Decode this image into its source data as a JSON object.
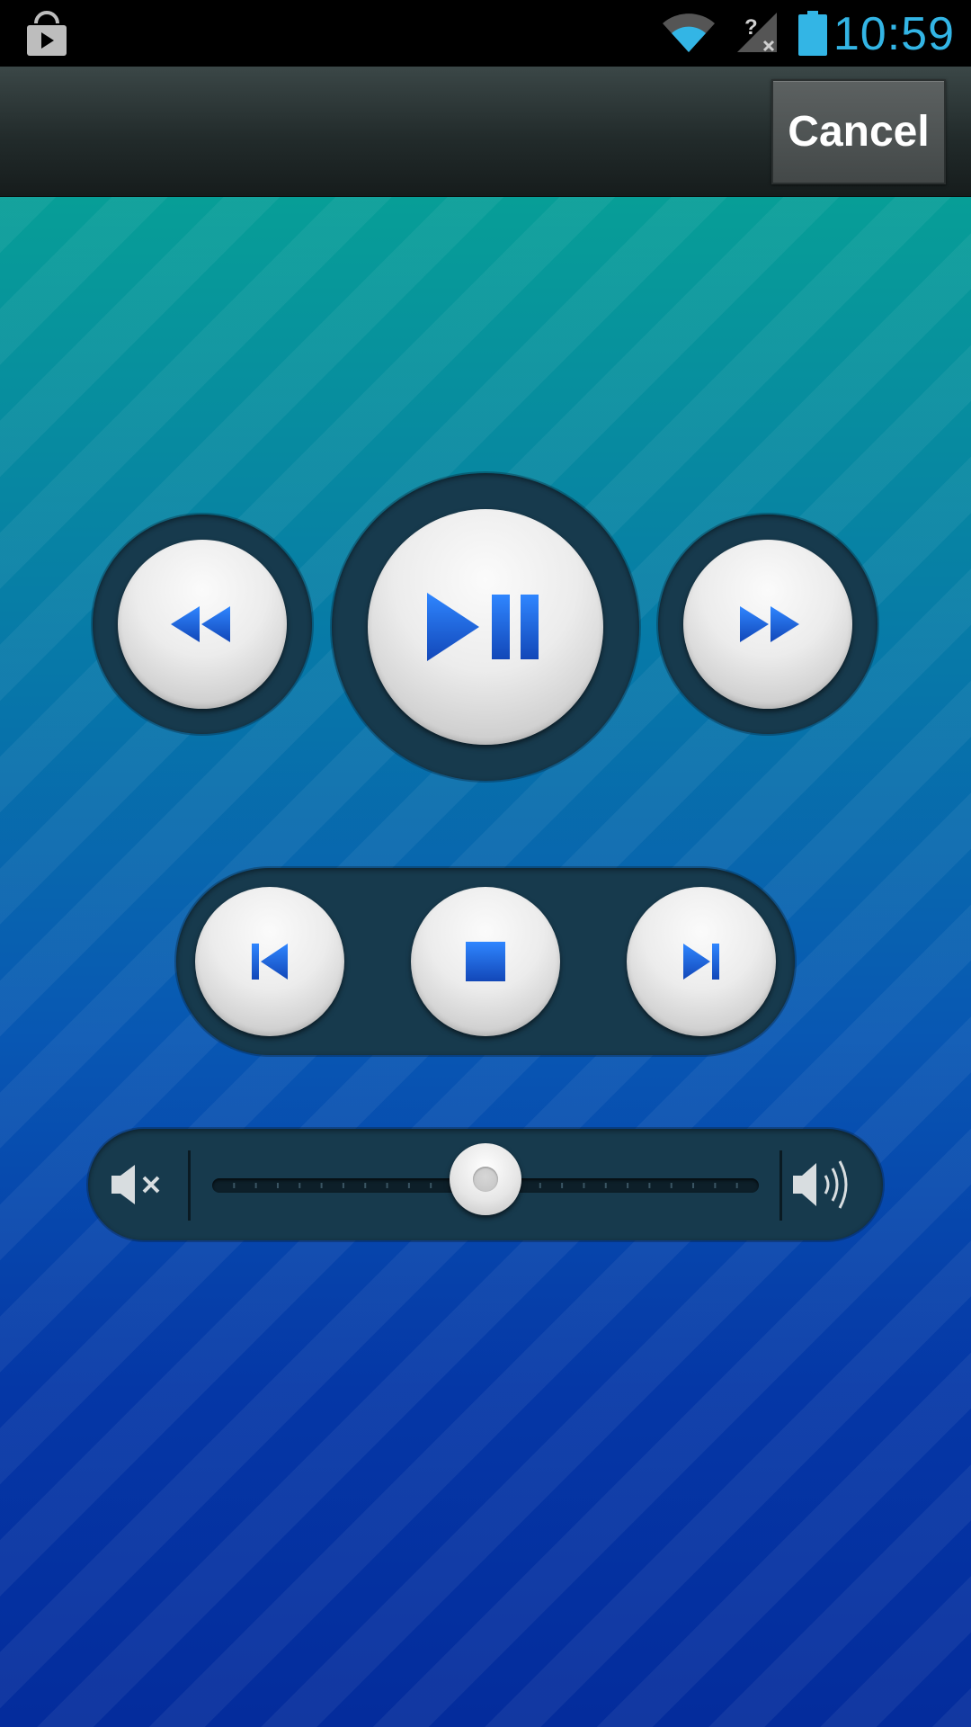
{
  "status_bar": {
    "time": "10:59",
    "icons": [
      "play-store-icon",
      "wifi-icon",
      "no-sim-signal-icon",
      "battery-icon"
    ],
    "time_color": "#33b5e5"
  },
  "action_bar": {
    "cancel_label": "Cancel"
  },
  "controls": {
    "primary": [
      "rewind-icon",
      "play-pause-icon",
      "fast-forward-icon"
    ],
    "secondary": [
      "skip-previous-icon",
      "stop-icon",
      "skip-next-icon"
    ],
    "icon_color": "#1e5fd0"
  },
  "volume": {
    "level": 0.5,
    "tick_count": 25,
    "icons": [
      "volume-mute-icon",
      "volume-max-icon"
    ]
  },
  "colors": {
    "accent": "#33b5e5",
    "background_top": "#079e97",
    "background_bottom": "#042c9c"
  }
}
